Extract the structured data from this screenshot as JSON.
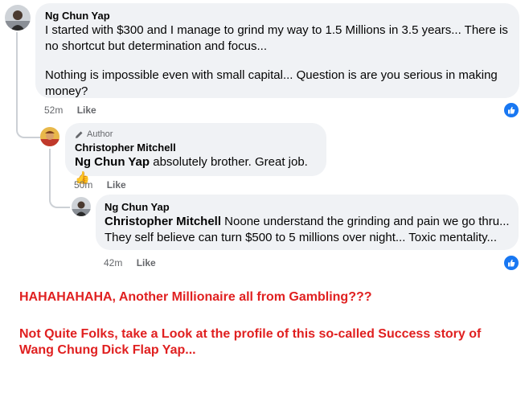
{
  "comment1": {
    "author": "Ng Chun Yap",
    "paragraph1": "I started with $300 and I manage to grind my way to 1.5 Millions in 3.5 years... There is no shortcut but determination and focus...",
    "paragraph2": "Nothing is impossible even with small capital... Question is are you serious in making money?",
    "time": "52m",
    "like_label": "Like",
    "reaction_icon": "like-thumb"
  },
  "reply1": {
    "badge": "Author",
    "author": "Christopher Mitchell",
    "mention": "Ng Chun Yap",
    "text": " absolutely brother. Great job.",
    "emoji": "👍",
    "time": "50m",
    "like_label": "Like"
  },
  "reply2": {
    "author": "Ng Chun Yap",
    "mention": "Christopher Mitchell",
    "text": " Noone understand the grinding and pain we go thru... They self believe can turn $500 to 5 millions over night... Toxic mentality...",
    "time": "42m",
    "like_label": "Like",
    "reaction_icon": "like-thumb"
  },
  "caption": {
    "line1": "HAHAHAHAHA, Another Millionaire all from Gambling???",
    "line2": "Not Quite Folks, take a Look at the profile of this so-called Success story of Wang Chung Dick Flap Yap..."
  },
  "colors": {
    "bubble": "#f0f2f5",
    "meta": "#65676b",
    "like_blue": "#1877f2",
    "caption_red": "#e02020",
    "thread_line": "#ccd0d5"
  }
}
